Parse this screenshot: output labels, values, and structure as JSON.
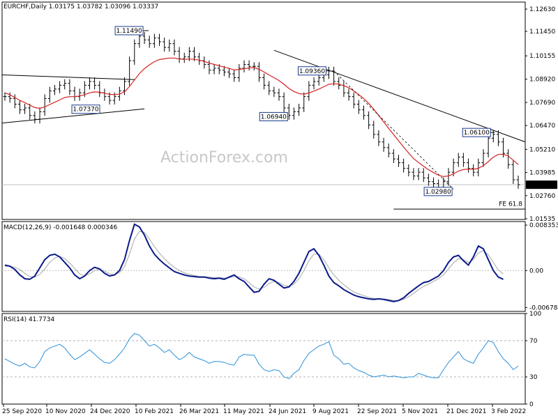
{
  "chart_data": [
    {
      "type": "ohlc",
      "header": "EURCHF,Daily  1.03175 1.03782 1.03096 1.03337",
      "ylim": [
        1.015,
        1.13
      ],
      "y_ticks": [
        "1.12630",
        "1.11450",
        "1.10155",
        "1.08920",
        "1.07690",
        "1.06470",
        "1.05210",
        "1.03985",
        "1.02760",
        "1.01535"
      ],
      "last_price": "1.03337",
      "x_ticks": [
        "25 Sep 2020",
        "10 Nov 2020",
        "24 Dec 2020",
        "10 Feb 2021",
        "26 Mar 2021",
        "11 May 2021",
        "24 Jun 2021",
        "9 Aug 2021",
        "22 Sep 2021",
        "5 Nov 2021",
        "21 Dec 2021",
        "3 Feb 2022"
      ],
      "series": [
        {
          "values": [
            1.08,
            1.079,
            1.076,
            1.073,
            1.074,
            1.07,
            1.068,
            1.072,
            1.079,
            1.083,
            1.084,
            1.086,
            1.087,
            1.083,
            1.08,
            1.082,
            1.086,
            1.088,
            1.086,
            1.082,
            1.08,
            1.078,
            1.08,
            1.083,
            1.088,
            1.099,
            1.108,
            1.112,
            1.11,
            1.108,
            1.111,
            1.109,
            1.106,
            1.108,
            1.104,
            1.1,
            1.101,
            1.104,
            1.101,
            1.099,
            1.097,
            1.094,
            1.095,
            1.094,
            1.093,
            1.092,
            1.09,
            1.095,
            1.097,
            1.096,
            1.096,
            1.09,
            1.086,
            1.083,
            1.082,
            1.08,
            1.074,
            1.07,
            1.072,
            1.074,
            1.08,
            1.086,
            1.088,
            1.09,
            1.0915,
            1.0936,
            1.088,
            1.086,
            1.082,
            1.08,
            1.076,
            1.073,
            1.07,
            1.065,
            1.06,
            1.056,
            1.053,
            1.05,
            1.047,
            1.045,
            1.042,
            1.04,
            1.038,
            1.04,
            1.037,
            1.035,
            1.034,
            1.032,
            1.035,
            1.04,
            1.045,
            1.048,
            1.045,
            1.042,
            1.04,
            1.045,
            1.05,
            1.058,
            1.06,
            1.056,
            1.05,
            1.044,
            1.036,
            1.0334
          ]
        },
        {
          "name": "",
          "values": [
            1.082,
            1.081,
            1.0795,
            1.078,
            1.0768,
            1.0755,
            1.0742,
            1.0738,
            1.0745,
            1.0758,
            1.077,
            1.0782,
            1.0795,
            1.08,
            1.08,
            1.0803,
            1.081,
            1.082,
            1.0825,
            1.0823,
            1.0818,
            1.0812,
            1.081,
            1.0813,
            1.0825,
            1.0853,
            1.0888,
            1.0922,
            1.0948,
            1.0968,
            1.0985,
            1.0996,
            1.1,
            1.1004,
            1.1004,
            1.0999,
            1.0997,
            1.0999,
            1.0997,
            1.0993,
            1.0986,
            1.0977,
            1.097,
            1.0963,
            1.0956,
            1.0949,
            1.0941,
            1.0943,
            1.0948,
            1.0951,
            1.0954,
            1.0944,
            1.093,
            1.0915,
            1.09,
            1.0885,
            1.0865,
            1.0843,
            1.0827,
            1.0816,
            1.0813,
            1.0819,
            1.0829,
            1.084,
            1.0852,
            1.0865,
            1.0868,
            1.0866,
            1.0858,
            1.0847,
            1.083,
            1.0811,
            1.079,
            1.0764,
            1.0733,
            1.07,
            1.0666,
            1.0632,
            1.0599,
            1.0566,
            1.0533,
            1.0502,
            1.0472,
            1.0451,
            1.0432,
            1.0413,
            1.0398,
            1.0384,
            1.0377,
            1.038,
            1.0391,
            1.0406,
            1.0414,
            1.0417,
            1.0415,
            1.0421,
            1.0434,
            1.0456,
            1.048,
            1.0494,
            1.0495,
            1.0485,
            1.0463,
            1.044
          ]
        }
      ],
      "annotations": [
        {
          "text": "1.11490",
          "x_index": 28,
          "y": 1.1149
        },
        {
          "text": "1.07370",
          "x_index": 14,
          "y": 1.0737
        },
        {
          "text": "1.09360",
          "x_index": 65,
          "y": 1.0936
        },
        {
          "text": "1.06940",
          "x_index": 57,
          "y": 1.0694
        },
        {
          "text": "1.06100",
          "x_index": 98,
          "y": 1.061
        },
        {
          "text": "1.02980",
          "x_index": 90,
          "y": 1.0298
        },
        {
          "text": "FE 61.8",
          "x_index": 99,
          "y": 1.021
        }
      ],
      "watermark": "ActionForex.com"
    },
    {
      "type": "line",
      "header": "MACD(12,26,9) -0.001648 0.000346",
      "ylim": [
        -0.0075,
        0.009
      ],
      "y_ticks": [
        "0.008353",
        "0.00",
        "-0.006788"
      ],
      "series": [
        {
          "values": [
            0.001,
            0.0008,
            0.0002,
            -0.0008,
            -0.0015,
            -0.0016,
            -0.001,
            0.0005,
            0.002,
            0.0028,
            0.003,
            0.0025,
            0.0015,
            0.0005,
            -0.0008,
            -0.0015,
            -0.001,
            0.0,
            0.0006,
            0.0003,
            -0.0005,
            -0.001,
            -0.0008,
            0.0,
            0.002,
            0.0055,
            0.0085,
            0.008,
            0.0065,
            0.0045,
            0.003,
            0.002,
            0.0012,
            0.0005,
            -0.0002,
            -0.0005,
            -0.0008,
            -0.001,
            -0.0011,
            -0.0012,
            -0.0012,
            -0.0014,
            -0.0015,
            -0.0014,
            -0.0016,
            -0.0012,
            -0.0008,
            -0.0015,
            -0.002,
            -0.003,
            -0.004,
            -0.0038,
            -0.0025,
            -0.0015,
            -0.0018,
            -0.0025,
            -0.0032,
            -0.003,
            -0.002,
            -0.0005,
            0.0015,
            0.0035,
            0.004,
            0.0028,
            0.001,
            -0.001,
            -0.0022,
            -0.0028,
            -0.0035,
            -0.004,
            -0.0045,
            -0.0048,
            -0.005,
            -0.0052,
            -0.0053,
            -0.0052,
            -0.0053,
            -0.0055,
            -0.0057,
            -0.0055,
            -0.005,
            -0.0042,
            -0.0035,
            -0.0028,
            -0.0022,
            -0.002,
            -0.0015,
            -0.001,
            0.0,
            0.0015,
            0.0025,
            0.0028,
            0.0018,
            0.001,
            0.0025,
            0.0045,
            0.004,
            0.002,
            0.0,
            -0.0012,
            -0.0016
          ]
        },
        {
          "values": [
            0.0008,
            0.0008,
            0.0006,
            0.0002,
            -0.0005,
            -0.0011,
            -0.0012,
            -0.0007,
            0.0003,
            0.0015,
            0.0023,
            0.0026,
            0.0022,
            0.0014,
            0.0004,
            -0.0006,
            -0.001,
            -0.0006,
            0.0,
            0.0002,
            -0.0001,
            -0.0006,
            -0.0008,
            -0.0004,
            0.0007,
            0.003,
            0.0058,
            0.0072,
            0.007,
            0.0058,
            0.0044,
            0.0032,
            0.0022,
            0.0013,
            0.0006,
            0.0,
            -0.0004,
            -0.0007,
            -0.0009,
            -0.0011,
            -0.0011,
            -0.0012,
            -0.0013,
            -0.0013,
            -0.0014,
            -0.0013,
            -0.0011,
            -0.0012,
            -0.0015,
            -0.0022,
            -0.003,
            -0.0034,
            -0.0031,
            -0.0024,
            -0.002,
            -0.0022,
            -0.0027,
            -0.0029,
            -0.0025,
            -0.0015,
            0.0,
            0.0018,
            0.003,
            0.003,
            0.002,
            0.0005,
            -0.0008,
            -0.0018,
            -0.0026,
            -0.0033,
            -0.0039,
            -0.0043,
            -0.0046,
            -0.0049,
            -0.0051,
            -0.0052,
            -0.0052,
            -0.0053,
            -0.0055,
            -0.0055,
            -0.0053,
            -0.0048,
            -0.0042,
            -0.0035,
            -0.0029,
            -0.0025,
            -0.002,
            -0.0015,
            -0.0008,
            0.0003,
            0.0014,
            0.0022,
            0.002,
            0.0015,
            0.002,
            0.0032,
            0.0037,
            0.0029,
            0.0015,
            0.0001,
            -0.0006
          ]
        }
      ]
    },
    {
      "type": "line",
      "header": "RSI(14) 41.7734",
      "ylim": [
        0,
        100
      ],
      "y_ticks": [
        "100",
        "70",
        "30",
        "0"
      ],
      "levels": [
        70,
        30
      ],
      "series": [
        {
          "values": [
            50,
            47,
            44,
            42,
            45,
            41,
            40,
            47,
            58,
            62,
            64,
            66,
            62,
            55,
            49,
            52,
            56,
            60,
            55,
            50,
            46,
            45,
            49,
            55,
            62,
            72,
            78,
            76,
            70,
            64,
            66,
            62,
            57,
            60,
            54,
            49,
            52,
            57,
            52,
            50,
            48,
            45,
            47,
            47,
            46,
            44,
            43,
            52,
            55,
            54,
            54,
            44,
            38,
            36,
            38,
            37,
            30,
            28,
            34,
            38,
            48,
            56,
            60,
            64,
            66,
            69,
            54,
            50,
            44,
            45,
            40,
            37,
            35,
            32,
            30,
            31,
            32,
            30,
            31,
            30,
            29,
            30,
            30,
            34,
            32,
            30,
            29,
            29,
            38,
            46,
            52,
            58,
            50,
            47,
            45,
            55,
            62,
            70,
            68,
            58,
            50,
            45,
            38,
            42
          ]
        }
      ]
    }
  ]
}
